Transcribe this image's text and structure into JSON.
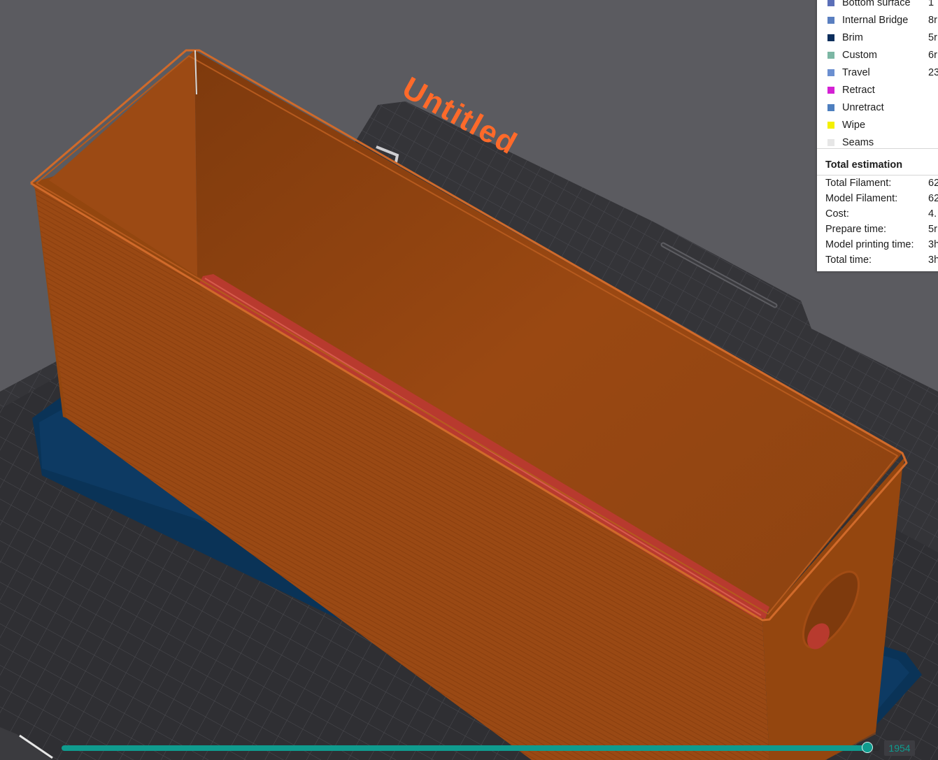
{
  "plate": {
    "name": "Untitled"
  },
  "legend": {
    "items": [
      {
        "label": "Bottom surface",
        "value": "1",
        "color": "#5b6fb8"
      },
      {
        "label": "Internal Bridge",
        "value": "8r",
        "color": "#5a7fc0"
      },
      {
        "label": "Brim",
        "value": "5r",
        "color": "#0c2e5c"
      },
      {
        "label": "Custom",
        "value": "6r",
        "color": "#7cb7a4"
      },
      {
        "label": "Travel",
        "value": "23",
        "color": "#6b8fd0"
      },
      {
        "label": "Retract",
        "value": "",
        "color": "#d421d4"
      },
      {
        "label": "Unretract",
        "value": "",
        "color": "#4e7fbf"
      },
      {
        "label": "Wipe",
        "value": "",
        "color": "#f4f000"
      },
      {
        "label": "Seams",
        "value": "",
        "color": "#e6e6e6"
      }
    ]
  },
  "estimation": {
    "title": "Total estimation",
    "rows": [
      {
        "label": "Total Filament:",
        "value": "62"
      },
      {
        "label": "Model Filament:",
        "value": "62"
      },
      {
        "label": "Cost:",
        "value": "4."
      },
      {
        "label": "Prepare time:",
        "value": "5r"
      },
      {
        "label": "Model printing time:",
        "value": "3h"
      },
      {
        "label": "Total time:",
        "value": "3h"
      }
    ]
  },
  "layer_slider": {
    "current_layer": "1954",
    "position": 0.985,
    "accent_color": "#0f9b8e"
  },
  "colors": {
    "model": "#9a4914",
    "model_inner": "#8f4310",
    "top_infill": "#b83a2e",
    "brim": "#0a3357",
    "plate": "#2f2f33",
    "background": "#5b5b60"
  }
}
